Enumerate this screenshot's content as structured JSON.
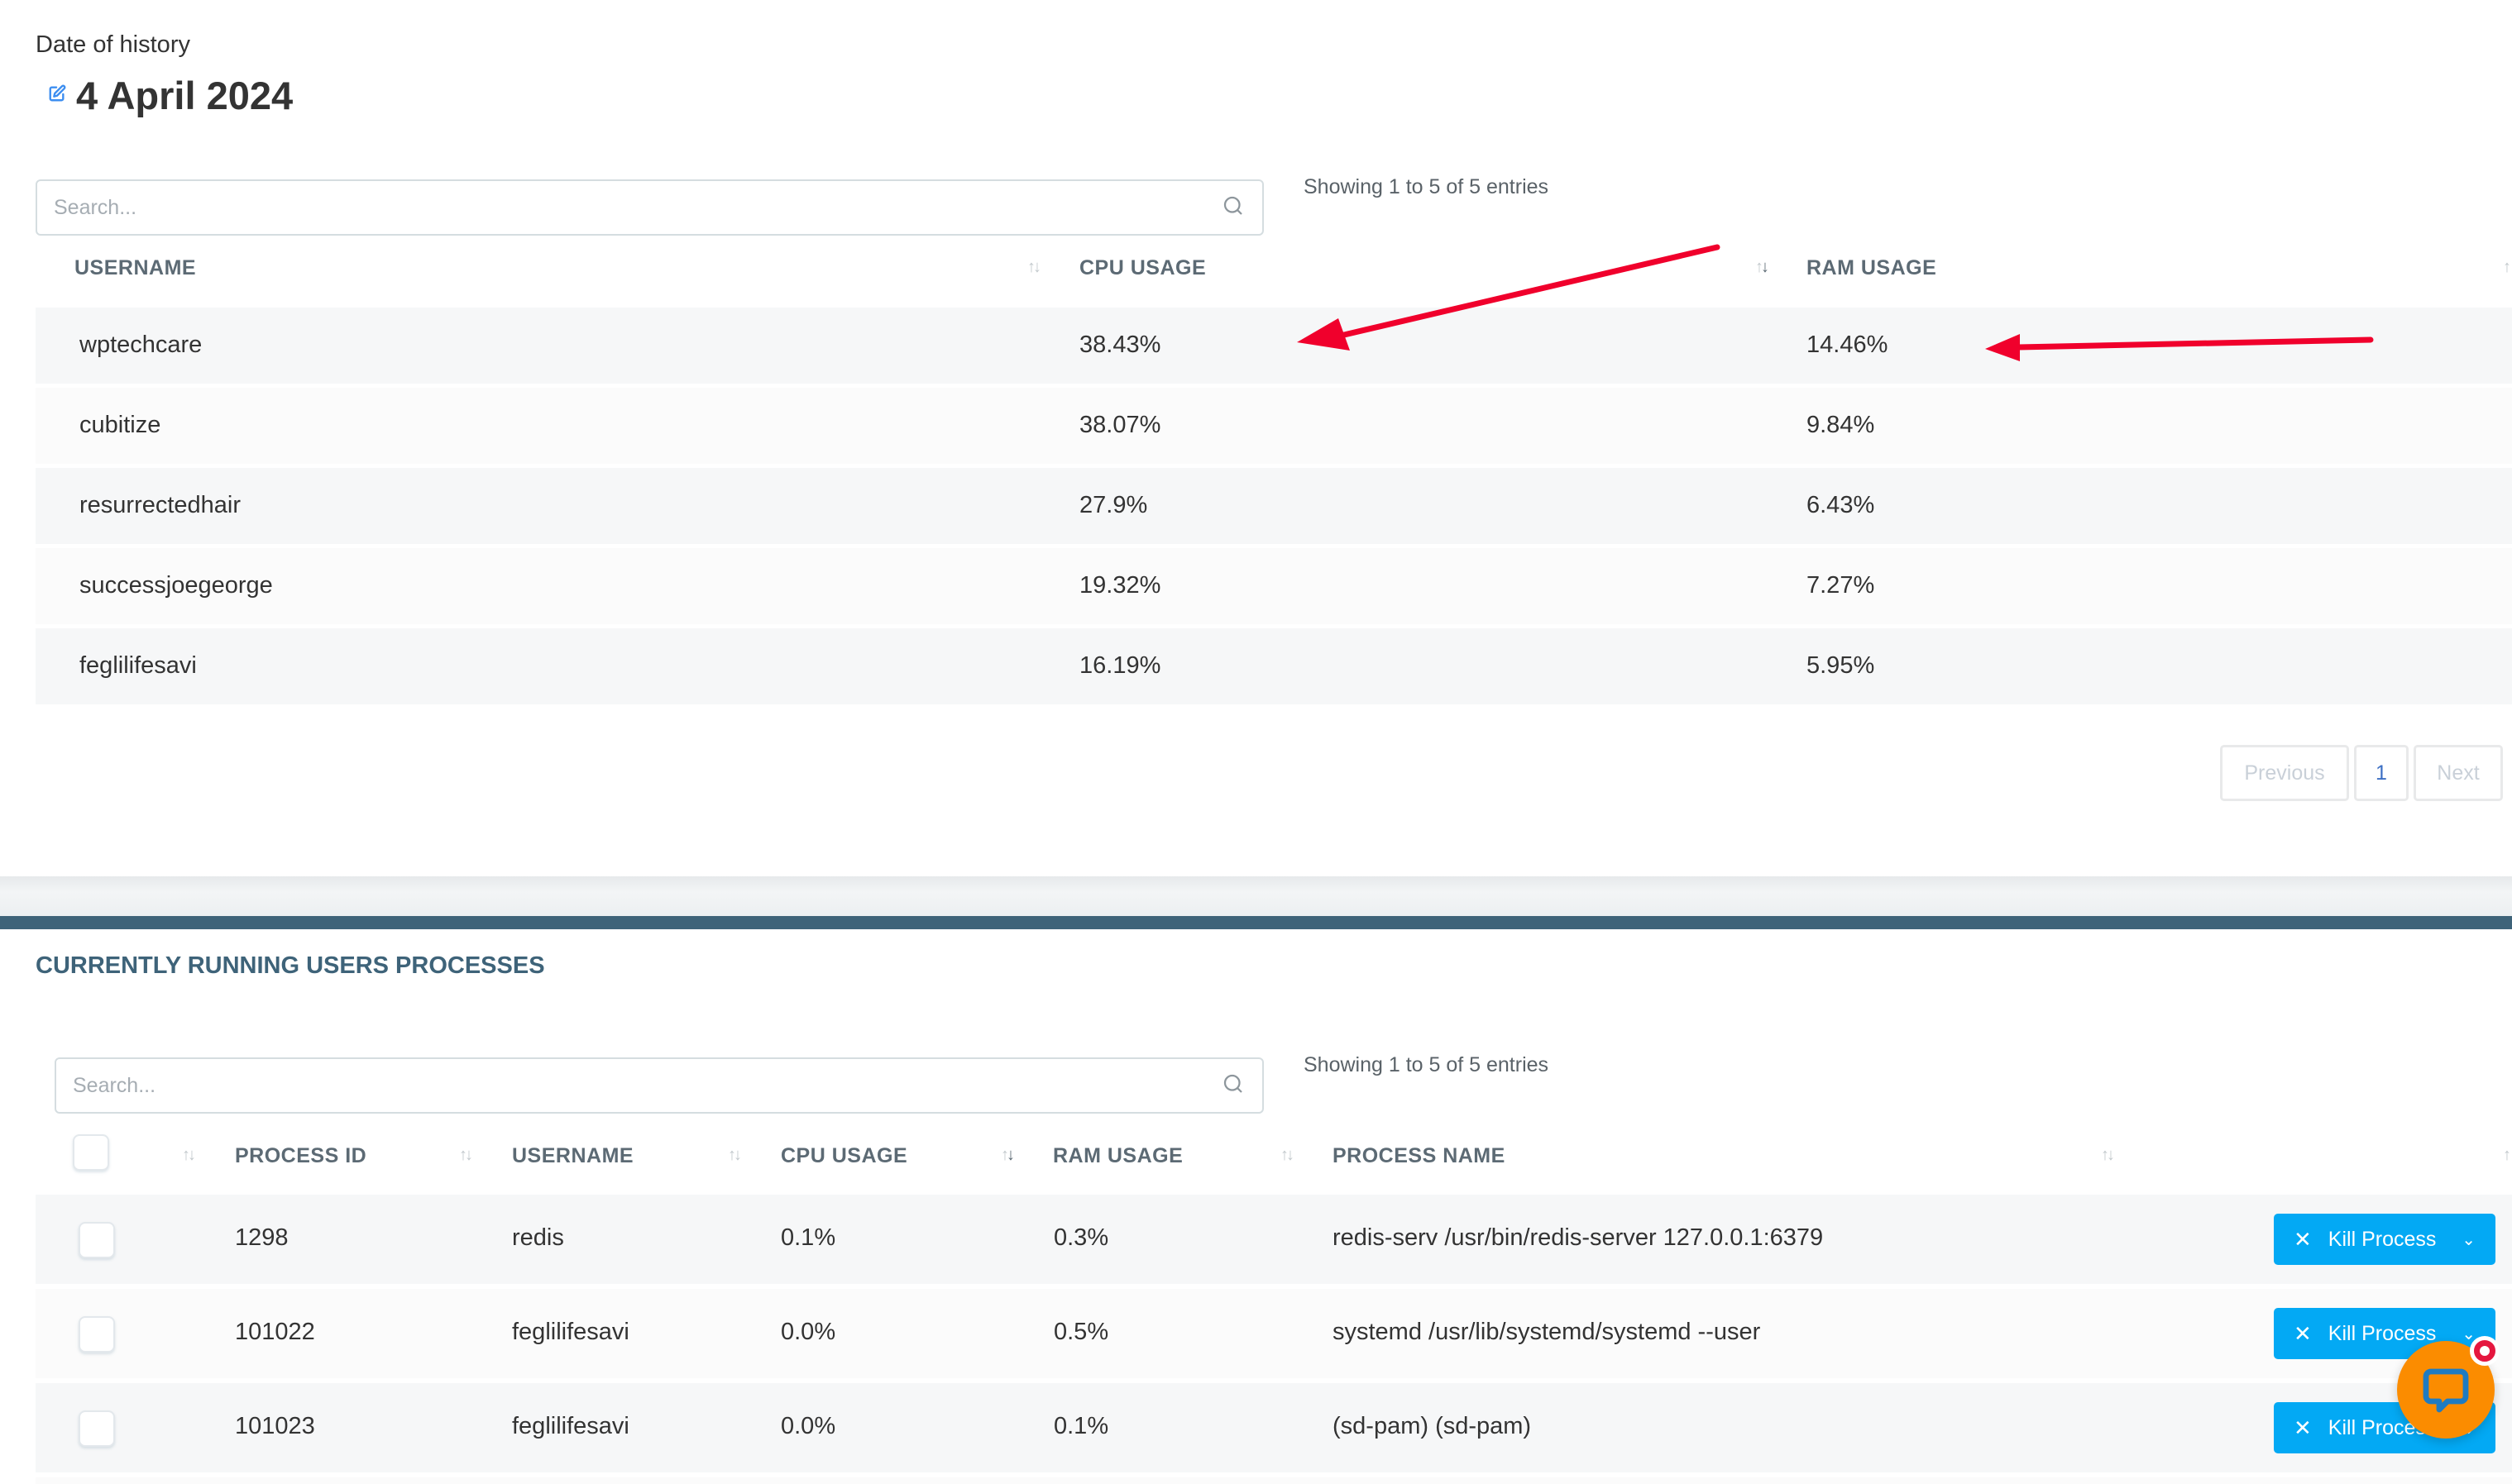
{
  "history": {
    "label": "Date of history",
    "date": "4 April 2024",
    "edit_icon": "edit-icon"
  },
  "top_table": {
    "search_placeholder": "Search...",
    "entries_info": "Showing 1 to 5 of 5 entries",
    "columns": [
      "USERNAME",
      "CPU USAGE",
      "RAM USAGE"
    ],
    "rows": [
      {
        "username": "wptechcare",
        "cpu": "38.43%",
        "ram": "14.46%"
      },
      {
        "username": "cubitize",
        "cpu": "38.07%",
        "ram": "9.84%"
      },
      {
        "username": "resurrectedhair",
        "cpu": "27.9%",
        "ram": "6.43%"
      },
      {
        "username": "successjoegeorge",
        "cpu": "19.32%",
        "ram": "7.27%"
      },
      {
        "username": "feglilifesavi",
        "cpu": "16.19%",
        "ram": "5.95%"
      }
    ],
    "pagination": {
      "previous": "Previous",
      "page": "1",
      "next": "Next"
    }
  },
  "processes": {
    "title": "CURRENTLY RUNNING USERS PROCESSES",
    "search_placeholder": "Search...",
    "entries_info": "Showing 1 to 5 of 5 entries",
    "columns": [
      "PROCESS ID",
      "USERNAME",
      "CPU USAGE",
      "RAM USAGE",
      "PROCESS NAME"
    ],
    "kill_label": "Kill Process",
    "rows": [
      {
        "pid": "1298",
        "username": "redis",
        "cpu": "0.1%",
        "ram": "0.3%",
        "name": "redis-serv /usr/bin/redis-server 127.0.0.1:6379"
      },
      {
        "pid": "101022",
        "username": "feglilifesavi",
        "cpu": "0.0%",
        "ram": "0.5%",
        "name": "systemd /usr/lib/systemd/systemd --user"
      },
      {
        "pid": "101023",
        "username": "feglilifesavi",
        "cpu": "0.0%",
        "ram": "0.1%",
        "name": "(sd-pam) (sd-pam)"
      }
    ]
  },
  "colors": {
    "accent": "#03a9f4",
    "section_bar": "#3e6379",
    "annotation_arrow": "#f0002c",
    "chat_button": "#fb8c00"
  }
}
